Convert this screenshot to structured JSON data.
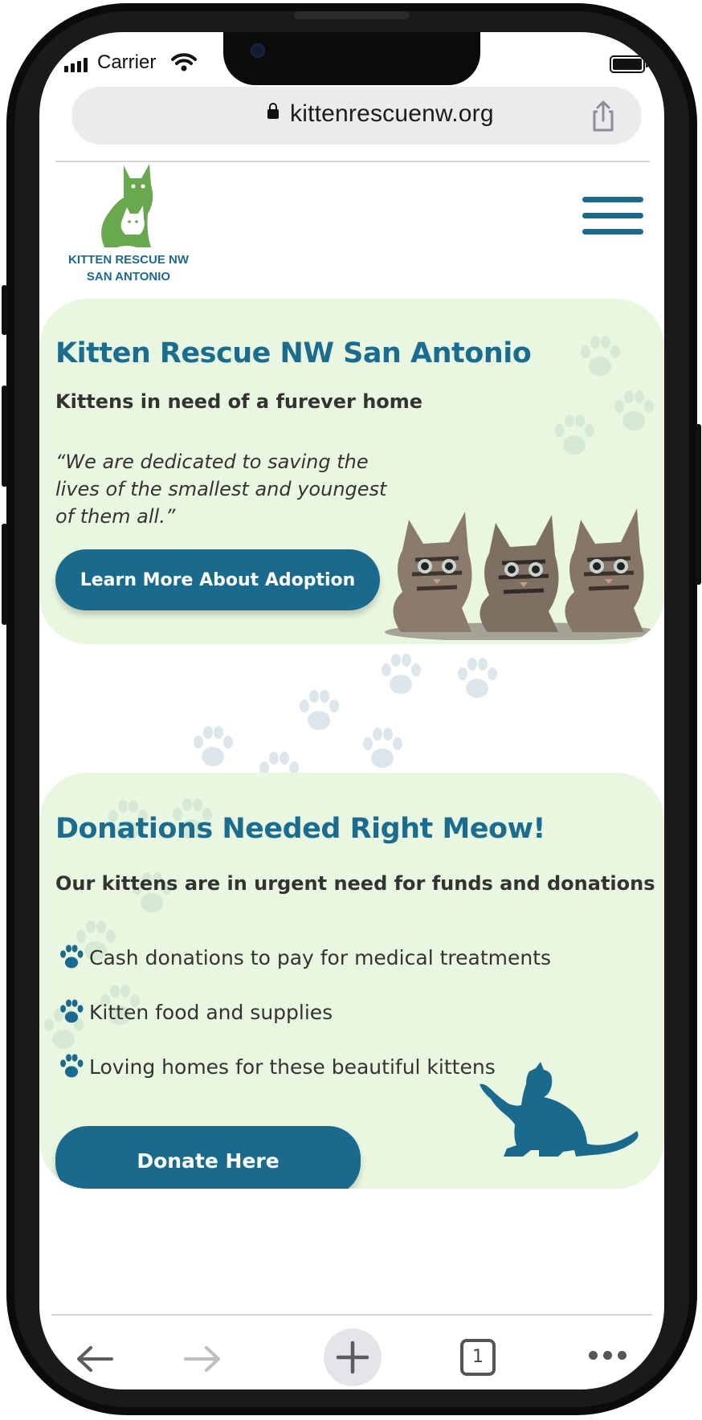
{
  "status_bar": {
    "carrier": "Carrier"
  },
  "browser": {
    "url": "kittenrescuenw.org",
    "tab_count": "1"
  },
  "header": {
    "logo_line1": "KITTEN RESCUE NW",
    "logo_line2": "SAN ANTONIO"
  },
  "hero": {
    "title": "Kitten Rescue NW San Antonio",
    "subtitle": "Kittens in need of a furever home",
    "quote": "“We are dedicated to saving the lives of the smallest and youngest of them all.”",
    "button": "Learn More About Adoption"
  },
  "donations": {
    "title": "Donations Needed Right Meow!",
    "subtitle": "Our kittens are in urgent need for funds and donations",
    "items": [
      "Cash donations to pay for medical treatments",
      "Kitten food and supplies",
      "Loving homes for these beautiful kittens"
    ],
    "button": "Donate Here"
  },
  "colors": {
    "brand_blue": "#1a6a8e",
    "card_green": "#eaf7e0",
    "logo_green": "#6aa84f",
    "paw_bg": "#dfe8ec"
  }
}
